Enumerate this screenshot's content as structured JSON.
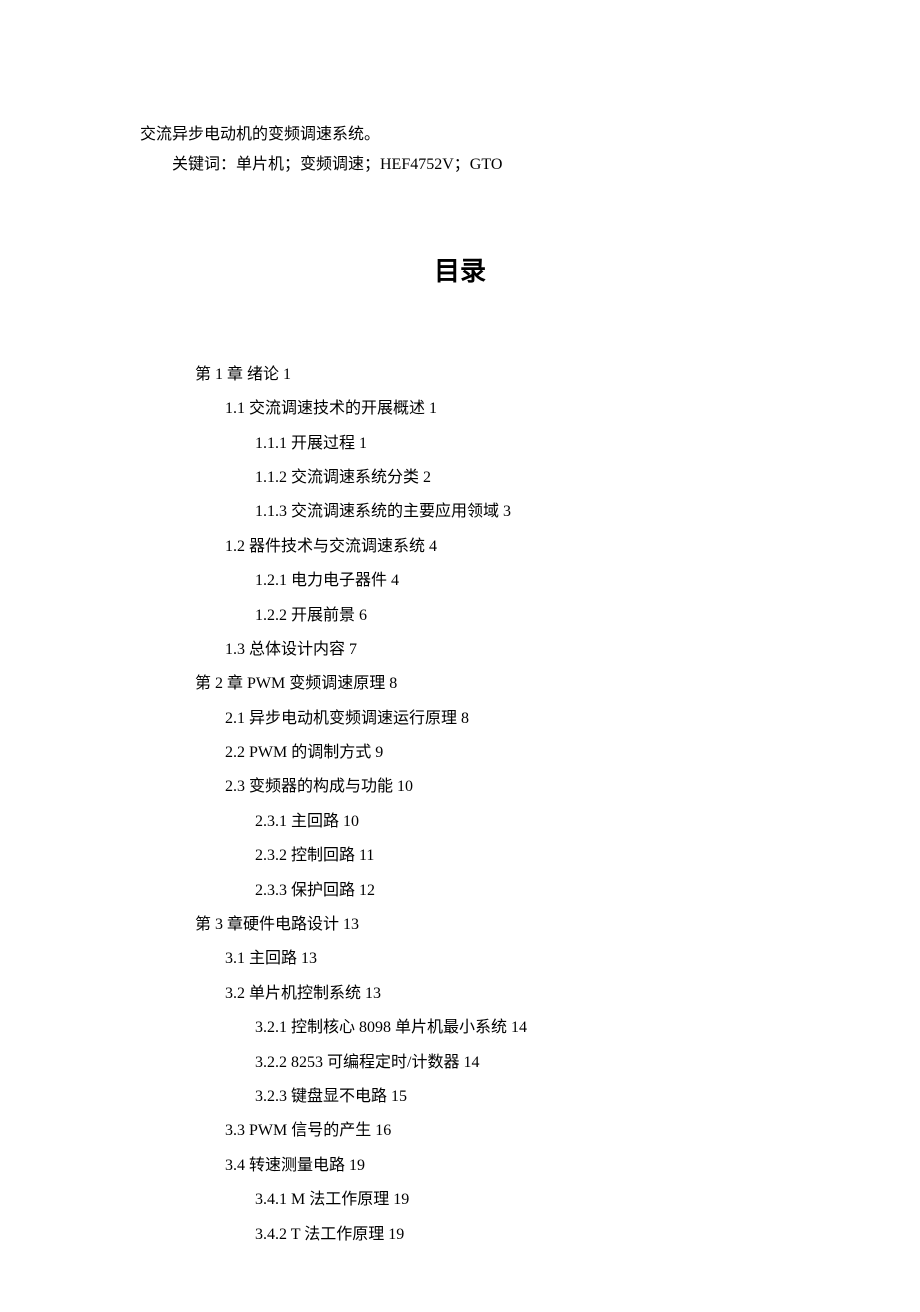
{
  "heading_text": "交流异步电动机的变频调速系统。",
  "keywords": "关键词：单片机；变频调速；HEF4752V；GTO",
  "toc_title": "目录",
  "toc": [
    {
      "level": 1,
      "text": "第 1 章 绪论 1"
    },
    {
      "level": 2,
      "text": "1.1  交流调速技术的开展概述 1"
    },
    {
      "level": 3,
      "text": "1.1.1  开展过程 1"
    },
    {
      "level": 3,
      "text": "1.1.2  交流调速系统分类 2"
    },
    {
      "level": 3,
      "text": "1.1.3  交流调速系统的主要应用领域 3"
    },
    {
      "level": 2,
      "text": "1.2  器件技术与交流调速系统 4"
    },
    {
      "level": 3,
      "text": "1.2.1  电力电子器件 4"
    },
    {
      "level": 3,
      "text": "1.2.2  开展前景 6"
    },
    {
      "level": 2,
      "text": "1.3  总体设计内容 7"
    },
    {
      "level": 1,
      "text": "第 2 章 PWM 变频调速原理 8"
    },
    {
      "level": 2,
      "text": "2.1  异步电动机变频调速运行原理 8"
    },
    {
      "level": 2,
      "text": "2.2   PWM 的调制方式 9"
    },
    {
      "level": 2,
      "text": "2.3   变频器的构成与功能 10"
    },
    {
      "level": 3,
      "text": "2.3.1  主回路 10"
    },
    {
      "level": 3,
      "text": "2.3.2  控制回路 11"
    },
    {
      "level": 3,
      "text": "2.3.3   保护回路 12"
    },
    {
      "level": 1,
      "text": "第 3 章硬件电路设计 13"
    },
    {
      "level": 2,
      "text": "3.1  主回路 13"
    },
    {
      "level": 2,
      "text": "3.2   单片机控制系统 13"
    },
    {
      "level": 3,
      "text": "3.2.1  控制核心 8098 单片机最小系统 14"
    },
    {
      "level": 3,
      "text": "3.2.2   8253 可编程定时/计数器 14"
    },
    {
      "level": 3,
      "text": "3.2.3   键盘显不电路 15"
    },
    {
      "level": 2,
      "text": "3.3   PWM 信号的产生 16"
    },
    {
      "level": 2,
      "text": "3.4   转速测量电路 19"
    },
    {
      "level": 3,
      "text": "3.4.1   M 法工作原理 19"
    },
    {
      "level": 3,
      "text": "3.4.2   T 法工作原理 19"
    }
  ]
}
